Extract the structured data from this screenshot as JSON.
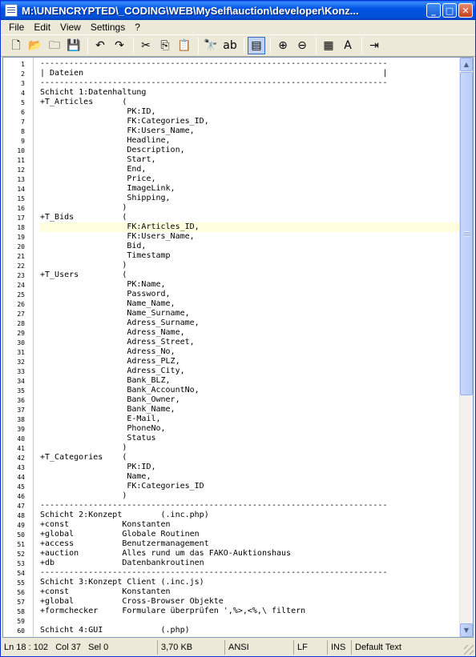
{
  "window": {
    "title": "M:\\UNENCRYPTED\\_CODING\\WEB\\MySelf\\auction\\developer\\Konz...",
    "buttons": {
      "minimize": "_",
      "maximize": "□",
      "close": "✕"
    }
  },
  "menu": [
    "File",
    "Edit",
    "View",
    "Settings",
    "?"
  ],
  "toolbar": [
    {
      "icon": "new-file-icon",
      "glyph": "🗋"
    },
    {
      "icon": "open-folder-icon",
      "glyph": "📂"
    },
    {
      "icon": "reload-icon",
      "glyph": "🗀"
    },
    {
      "icon": "save-icon",
      "glyph": "💾"
    },
    {
      "sep": true
    },
    {
      "icon": "undo-icon",
      "glyph": "↶"
    },
    {
      "icon": "redo-icon",
      "glyph": "↷"
    },
    {
      "sep": true
    },
    {
      "icon": "cut-icon",
      "glyph": "✂"
    },
    {
      "icon": "copy-icon",
      "glyph": "⎘"
    },
    {
      "icon": "paste-icon",
      "glyph": "📋"
    },
    {
      "sep": true
    },
    {
      "icon": "find-icon",
      "glyph": "🔭"
    },
    {
      "icon": "replace-icon",
      "glyph": "ab"
    },
    {
      "sep": true
    },
    {
      "icon": "word-wrap-icon",
      "glyph": "▤",
      "active": true
    },
    {
      "sep": true
    },
    {
      "icon": "zoom-in-icon",
      "glyph": "⊕"
    },
    {
      "icon": "zoom-out-icon",
      "glyph": "⊖"
    },
    {
      "sep": true
    },
    {
      "icon": "settings-icon",
      "glyph": "▦"
    },
    {
      "icon": "font-icon",
      "glyph": "A"
    },
    {
      "sep": true
    },
    {
      "icon": "exit-icon",
      "glyph": "⇥"
    }
  ],
  "lines": [
    "------------------------------------------------------------------------",
    "| Dateien                                                              |",
    "------------------------------------------------------------------------",
    "Schicht 1:Datenhaltung",
    "+T_Articles      (",
    "                  PK:ID,",
    "                  FK:Categories_ID,",
    "                  FK:Users_Name,",
    "                  Headline,",
    "                  Description,",
    "                  Start,",
    "                  End,",
    "                  Price,",
    "                  ImageLink,",
    "                  Shipping,",
    "                 )",
    "+T_Bids          (",
    "                  FK:Articles_ID,",
    "                  FK:Users_Name,",
    "                  Bid,",
    "                  Timestamp",
    "                 )",
    "+T_Users         (",
    "                  PK:Name,",
    "                  Password,",
    "                  Name_Name,",
    "                  Name_Surname,",
    "                  Adress_Surname,",
    "                  Adress_Name,",
    "                  Adress_Street,",
    "                  Adress_No,",
    "                  Adress_PLZ,",
    "                  Adress_City,",
    "                  Bank_BLZ,",
    "                  Bank_AccountNo,",
    "                  Bank_Owner,",
    "                  Bank_Name,",
    "                  E-Mail,",
    "                  PhoneNo,",
    "                  Status",
    "                 )",
    "+T_Categories    (",
    "                  PK:ID,",
    "                  Name,",
    "                  FK:Categories_ID",
    "                 )",
    "------------------------------------------------------------------------",
    "Schicht 2:Konzept        (.inc.php)",
    "+const           Konstanten",
    "+global          Globale Routinen",
    "+access          Benutzermanagement",
    "+auction         Alles rund um das FAKO-Auktionshaus",
    "+db              Datenbankroutinen",
    "------------------------------------------------------------------------",
    "Schicht 3:Konzept Client (.inc.js)",
    "+const           Konstanten",
    "+global          Cross-Browser Objekte",
    "+formchecker     Formulare überprüfen ',%>,<%,\\ filtern",
    "",
    "Schicht 4:GUI            (.php)"
  ],
  "current_line": 18,
  "scrollbar": {
    "up": "▲",
    "down": "▼"
  },
  "status": {
    "position": "Ln 18 : 102   Col 37   Sel 0",
    "size": "3,70 KB",
    "encoding": "ANSI",
    "eol": "LF",
    "mode": "INS",
    "scheme": "Default Text"
  }
}
